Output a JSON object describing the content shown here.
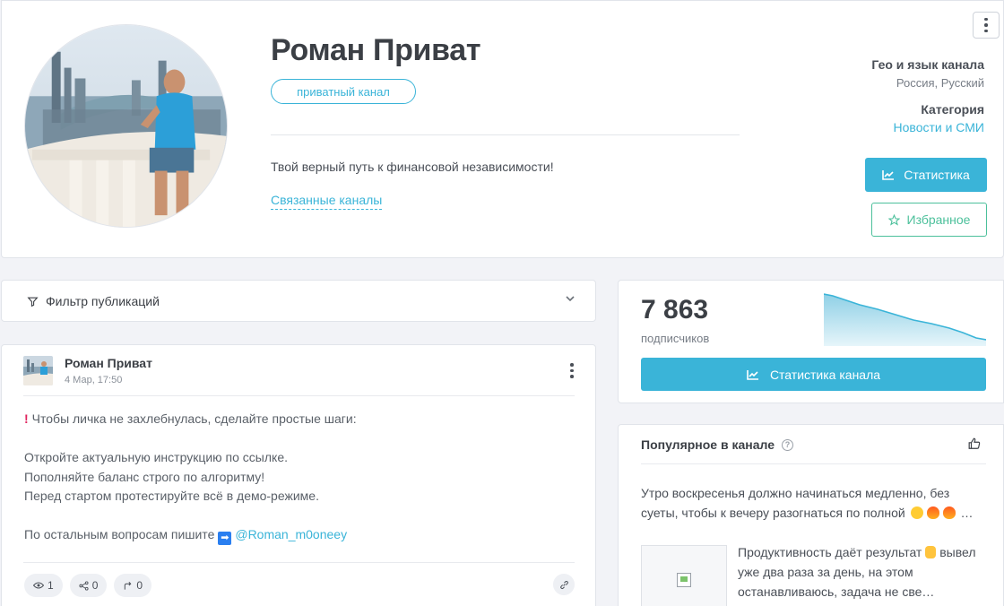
{
  "channel": {
    "title": "Роман Приват",
    "badge": "приватный канал",
    "description": "Твой верный путь к финансовой независимости!",
    "related_link": "Связанные каналы",
    "geo_label": "Гео и язык канала",
    "geo_value": "Россия, Русский",
    "category_label": "Категория",
    "category_value": "Новости и СМИ",
    "stats_button": "Статистика",
    "favorite_button": "Избранное"
  },
  "filter": {
    "label": "Фильтр публикаций"
  },
  "post": {
    "author": "Роман Приват",
    "date": "4 Мар, 17:50",
    "line1": "Чтобы личка не захлебнулась, сделайте простые шаги:",
    "line2": "Откройте актуальную инструкцию по ссылке.",
    "line3": "Пополняйте баланс строго по алгоритму!",
    "line4": "Перед стартом протестируйте всё в демо-режиме.",
    "line5": "По остальным вопросам пишите",
    "arrow": "➡",
    "mention": "@Roman_m0oneey",
    "views": "1",
    "shares": "0",
    "forwards": "0"
  },
  "subscribers": {
    "count": "7 863",
    "label": "подписчиков",
    "button": "Статистика канала"
  },
  "popular": {
    "title": "Популярное в канале",
    "help": "?",
    "item1_text": "Утро воскресенья должно начинаться медленно, без суеты, чтобы к вечеру разогнаться по полной",
    "item1_ellipsis": "…",
    "item2_text": "Продуктивность даёт результат",
    "item2_text_cont": "вывел уже два раза за день, на этом останавливаюсь, задача не све…"
  },
  "colors": {
    "accent": "#3ab4d8",
    "favorite": "#4cc09b",
    "background": "#f2f3f7"
  },
  "icons": {
    "kebab": "kebab-menu-icon",
    "chart": "chart-line-icon",
    "star": "star-icon",
    "filter": "filter-icon",
    "chevron": "chevron-down-icon",
    "eye": "eye-icon",
    "share": "share-icon",
    "forward": "forward-icon",
    "link": "link-icon",
    "thumb": "thumbs-up-icon"
  }
}
